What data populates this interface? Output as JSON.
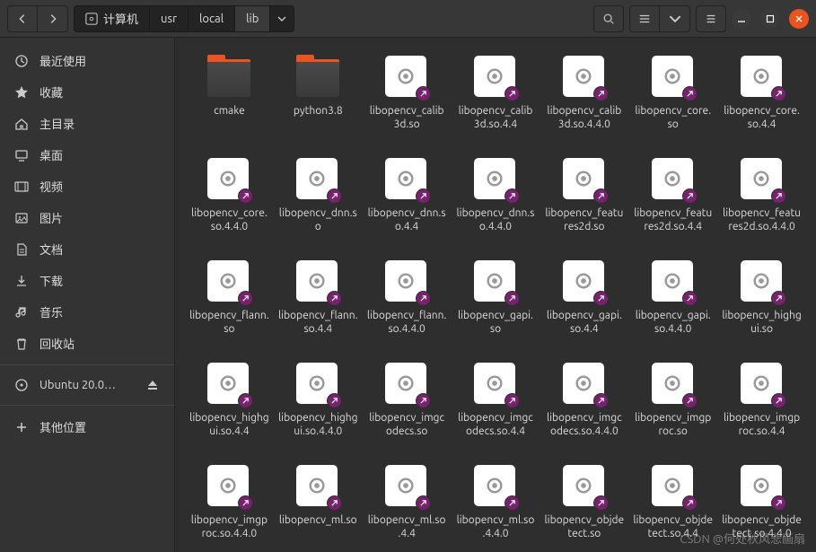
{
  "path": {
    "root": "计算机",
    "segments": [
      "usr",
      "local",
      "lib"
    ]
  },
  "sidebar": {
    "items": [
      {
        "id": "recent",
        "label": "最近使用",
        "icon": "clock"
      },
      {
        "id": "starred",
        "label": "收藏",
        "icon": "star"
      },
      {
        "id": "home",
        "label": "主目录",
        "icon": "home"
      },
      {
        "id": "desktop",
        "label": "桌面",
        "icon": "desktop"
      },
      {
        "id": "videos",
        "label": "视频",
        "icon": "video"
      },
      {
        "id": "pictures",
        "label": "图片",
        "icon": "image"
      },
      {
        "id": "documents",
        "label": "文档",
        "icon": "doc"
      },
      {
        "id": "downloads",
        "label": "下载",
        "icon": "download"
      },
      {
        "id": "music",
        "label": "音乐",
        "icon": "music"
      },
      {
        "id": "trash",
        "label": "回收站",
        "icon": "trash"
      },
      {
        "id": "disk",
        "label": "Ubuntu 20.0…",
        "icon": "disk",
        "eject": true,
        "sep": true
      },
      {
        "id": "other",
        "label": "其他位置",
        "icon": "plus",
        "sep": true
      }
    ]
  },
  "files": [
    {
      "name": "cmake",
      "type": "folder"
    },
    {
      "name": "python3.8",
      "type": "folder"
    },
    {
      "name": "libopencv_calib3d.so",
      "type": "so",
      "link": true
    },
    {
      "name": "libopencv_calib3d.so.4.4",
      "type": "so",
      "link": true
    },
    {
      "name": "libopencv_calib3d.so.4.4.0",
      "type": "so",
      "link": true
    },
    {
      "name": "libopencv_core.so",
      "type": "so",
      "link": true
    },
    {
      "name": "libopencv_core.so.4.4",
      "type": "so",
      "link": true
    },
    {
      "name": "libopencv_core.so.4.4.0",
      "type": "so",
      "link": true
    },
    {
      "name": "libopencv_dnn.so",
      "type": "so",
      "link": true
    },
    {
      "name": "libopencv_dnn.so.4.4",
      "type": "so",
      "link": true
    },
    {
      "name": "libopencv_dnn.so.4.4.0",
      "type": "so",
      "link": true
    },
    {
      "name": "libopencv_features2d.so",
      "type": "so",
      "link": true
    },
    {
      "name": "libopencv_features2d.so.4.4",
      "type": "so",
      "link": true
    },
    {
      "name": "libopencv_features2d.so.4.4.0",
      "type": "so",
      "link": true
    },
    {
      "name": "libopencv_flann.so",
      "type": "so",
      "link": true
    },
    {
      "name": "libopencv_flann.so.4.4",
      "type": "so",
      "link": true
    },
    {
      "name": "libopencv_flann.so.4.4.0",
      "type": "so",
      "link": true
    },
    {
      "name": "libopencv_gapi.so",
      "type": "so",
      "link": true
    },
    {
      "name": "libopencv_gapi.so.4.4",
      "type": "so",
      "link": true
    },
    {
      "name": "libopencv_gapi.so.4.4.0",
      "type": "so",
      "link": true
    },
    {
      "name": "libopencv_highgui.so",
      "type": "so",
      "link": true
    },
    {
      "name": "libopencv_highgui.so.4.4",
      "type": "so",
      "link": true
    },
    {
      "name": "libopencv_highgui.so.4.4.0",
      "type": "so",
      "link": true
    },
    {
      "name": "libopencv_imgcodecs.so",
      "type": "so",
      "link": true
    },
    {
      "name": "libopencv_imgcodecs.so.4.4",
      "type": "so",
      "link": true
    },
    {
      "name": "libopencv_imgcodecs.so.4.4.0",
      "type": "so",
      "link": true
    },
    {
      "name": "libopencv_imgproc.so",
      "type": "so",
      "link": true
    },
    {
      "name": "libopencv_imgproc.so.4.4",
      "type": "so",
      "link": true
    },
    {
      "name": "libopencv_imgproc.so.4.4.0",
      "type": "so",
      "link": true
    },
    {
      "name": "libopencv_ml.so",
      "type": "so",
      "link": true
    },
    {
      "name": "libopencv_ml.so.4.4",
      "type": "so",
      "link": true
    },
    {
      "name": "libopencv_ml.so.4.4.0",
      "type": "so",
      "link": true
    },
    {
      "name": "libopencv_objdetect.so",
      "type": "so",
      "link": true
    },
    {
      "name": "libopencv_objdetect.so.4.4",
      "type": "so",
      "link": true
    },
    {
      "name": "libopencv_objdetect.so.4.4.0",
      "type": "so",
      "link": true
    }
  ],
  "watermark": "CSDN @何处秋风悲画扇"
}
